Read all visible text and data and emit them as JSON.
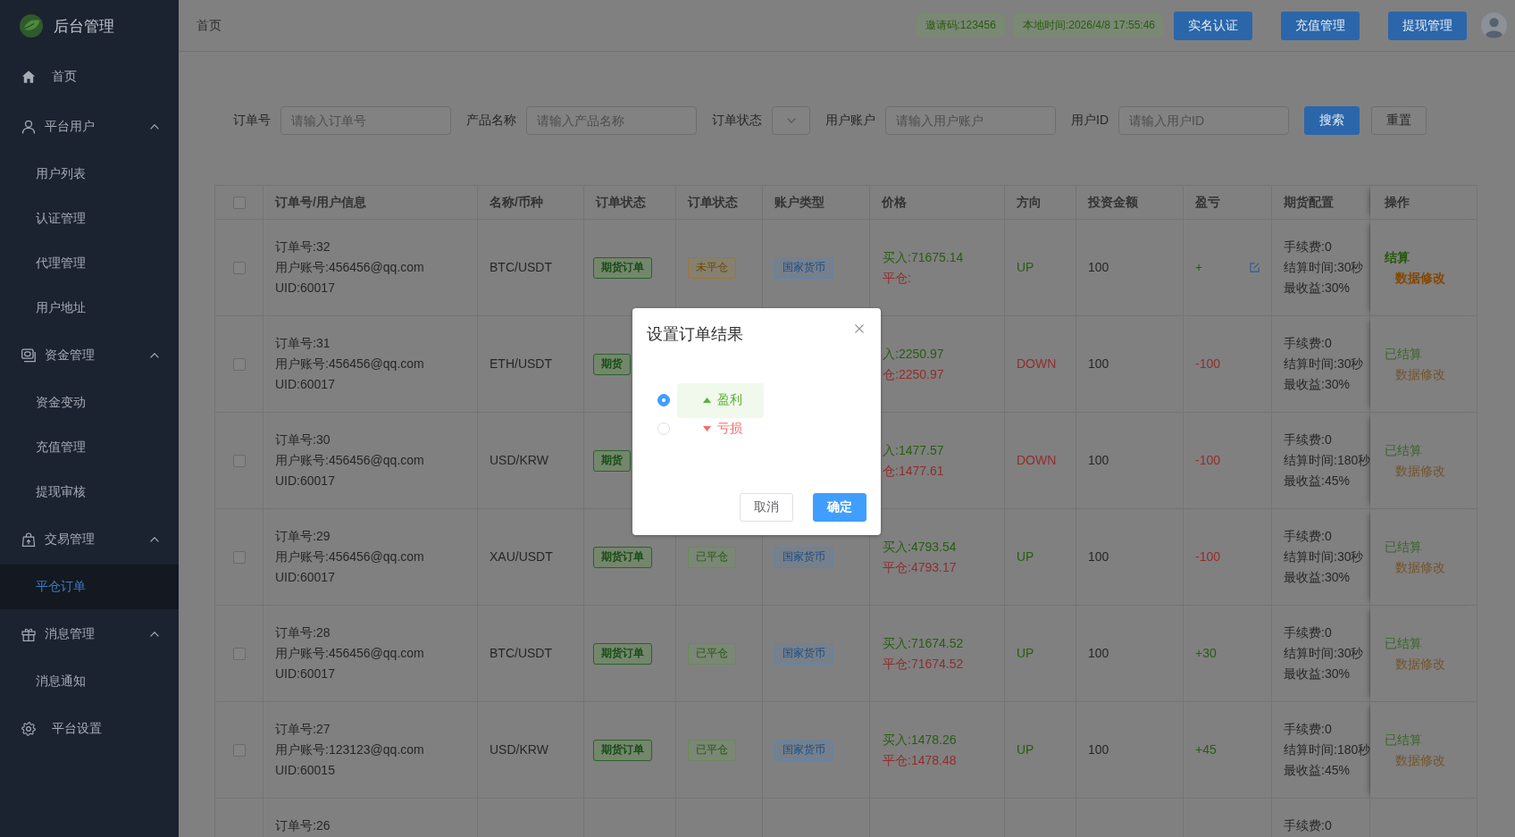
{
  "sidebar": {
    "logo_text": "后台管理",
    "items": [
      {
        "label": "首页",
        "kind": "link",
        "selected": false
      },
      {
        "label": "平台用户",
        "kind": "group",
        "expanded": true,
        "children": [
          {
            "label": "用户列表",
            "selected": false
          },
          {
            "label": "认证管理",
            "selected": false
          },
          {
            "label": "代理管理",
            "selected": false
          },
          {
            "label": "用户地址",
            "selected": false
          }
        ]
      },
      {
        "label": "资金管理",
        "kind": "group",
        "expanded": true,
        "children": [
          {
            "label": "资金变动",
            "selected": false
          },
          {
            "label": "充值管理",
            "selected": false
          },
          {
            "label": "提现审核",
            "selected": false
          }
        ]
      },
      {
        "label": "交易管理",
        "kind": "group",
        "expanded": true,
        "children": [
          {
            "label": "平仓订单",
            "selected": true
          }
        ]
      },
      {
        "label": "消息管理",
        "kind": "group",
        "expanded": true,
        "children": [
          {
            "label": "消息通知",
            "selected": false
          }
        ]
      },
      {
        "label": "平台设置",
        "kind": "link",
        "selected": false
      }
    ]
  },
  "header": {
    "breadcrumb": "首页",
    "tags": [
      "邀请码:123456",
      "本地时间:2026/4/8 17:55:46"
    ],
    "buttons": [
      "实名认证",
      "充值管理",
      "提现管理"
    ]
  },
  "filters": {
    "fields": [
      {
        "label": "订单号",
        "kind": "input",
        "placeholder": "请输入订单号"
      },
      {
        "label": "产品名称",
        "kind": "input",
        "placeholder": "请输入产品名称"
      },
      {
        "label": "订单状态",
        "kind": "select"
      },
      {
        "label": "用户账户",
        "kind": "input",
        "placeholder": "请输入用户账户"
      },
      {
        "label": "用户ID",
        "kind": "input",
        "placeholder": "请输入用户ID"
      }
    ],
    "buttons": [
      {
        "label": "搜索",
        "kind": "primary"
      },
      {
        "label": "重置",
        "kind": "default"
      }
    ]
  },
  "table": {
    "header_checkbox": {
      "checked": false
    },
    "columns": [
      "订单号/用户信息",
      "名称/币种",
      "订单状态",
      "订单状态",
      "账户类型",
      "价格",
      "方向",
      "投资金额",
      "盈亏",
      "期货配置",
      "操作"
    ],
    "rows": [
      {
        "checked": false,
        "info": [
          "订单号:32",
          "用户账号:456456@qq.com",
          "UID:60017"
        ],
        "symbol": "BTC/USDT",
        "order_type": "期货订单",
        "status": {
          "label": "未平仓",
          "kind": "open"
        },
        "account_type": "国家货币",
        "price": [
          {
            "text": "买入:71675.14",
            "kind": "buy"
          },
          {
            "text": "平仓:",
            "kind": "close"
          }
        ],
        "direction": {
          "text": "UP",
          "kind": "up"
        },
        "amount": "100",
        "pl": {
          "text": "+",
          "kind": "profit",
          "editable": true
        },
        "config": [
          "手续费:0",
          "结算时间:30秒",
          "最收益:30%"
        ],
        "actions": [
          {
            "label": "结算",
            "kind": "settle",
            "disabled": false
          },
          {
            "label": "数据修改",
            "kind": "edit",
            "disabled": false
          }
        ]
      },
      {
        "checked": false,
        "info": [
          "订单号:31",
          "用户账号:456456@qq.com",
          "UID:60017"
        ],
        "symbol": "ETH/USDT",
        "order_type": "期货",
        "price": [
          {
            "text": "入:2250.97",
            "kind": "buy"
          },
          {
            "text": "仓:2250.97",
            "kind": "close"
          }
        ],
        "direction": {
          "text": "DOWN",
          "kind": "down"
        },
        "amount": "100",
        "pl": {
          "text": "-100",
          "kind": "loss",
          "editable": false
        },
        "config": [
          "手续费:0",
          "结算时间:30秒",
          "最收益:30%"
        ],
        "actions": [
          {
            "label": "已结算",
            "kind": "settle",
            "disabled": true
          },
          {
            "label": "数据修改",
            "kind": "edit",
            "disabled": true
          }
        ]
      },
      {
        "checked": false,
        "info": [
          "订单号:30",
          "用户账号:456456@qq.com",
          "UID:60017"
        ],
        "symbol": "USD/KRW",
        "order_type": "期货",
        "price": [
          {
            "text": "入:1477.57",
            "kind": "buy"
          },
          {
            "text": "仓:1477.61",
            "kind": "close"
          }
        ],
        "direction": {
          "text": "DOWN",
          "kind": "down"
        },
        "amount": "100",
        "pl": {
          "text": "-100",
          "kind": "loss",
          "editable": false
        },
        "config": [
          "手续费:0",
          "结算时间:180秒",
          "最收益:45%"
        ],
        "actions": [
          {
            "label": "已结算",
            "kind": "settle",
            "disabled": true
          },
          {
            "label": "数据修改",
            "kind": "edit",
            "disabled": true
          }
        ]
      },
      {
        "checked": false,
        "info": [
          "订单号:29",
          "用户账号:456456@qq.com",
          "UID:60017"
        ],
        "symbol": "XAU/USDT",
        "order_type": "期货订单",
        "status": {
          "label": "已平仓",
          "kind": "closed"
        },
        "account_type": "国家货币",
        "price": [
          {
            "text": "买入:4793.54",
            "kind": "buy"
          },
          {
            "text": "平仓:4793.17",
            "kind": "close"
          }
        ],
        "direction": {
          "text": "UP",
          "kind": "up"
        },
        "amount": "100",
        "pl": {
          "text": "-100",
          "kind": "loss",
          "editable": false
        },
        "config": [
          "手续费:0",
          "结算时间:30秒",
          "最收益:30%"
        ],
        "actions": [
          {
            "label": "已结算",
            "kind": "settle",
            "disabled": true
          },
          {
            "label": "数据修改",
            "kind": "edit",
            "disabled": true
          }
        ]
      },
      {
        "checked": false,
        "info": [
          "订单号:28",
          "用户账号:456456@qq.com",
          "UID:60017"
        ],
        "symbol": "BTC/USDT",
        "order_type": "期货订单",
        "status": {
          "label": "已平仓",
          "kind": "closed"
        },
        "account_type": "国家货币",
        "price": [
          {
            "text": "买入:71674.52",
            "kind": "buy"
          },
          {
            "text": "平仓:71674.52",
            "kind": "close"
          }
        ],
        "direction": {
          "text": "UP",
          "kind": "up"
        },
        "amount": "100",
        "pl": {
          "text": "+30",
          "kind": "profit",
          "editable": false
        },
        "config": [
          "手续费:0",
          "结算时间:30秒",
          "最收益:30%"
        ],
        "actions": [
          {
            "label": "已结算",
            "kind": "settle",
            "disabled": true
          },
          {
            "label": "数据修改",
            "kind": "edit",
            "disabled": true
          }
        ]
      },
      {
        "checked": false,
        "info": [
          "订单号:27",
          "用户账号:123123@qq.com",
          "UID:60015"
        ],
        "symbol": "USD/KRW",
        "order_type": "期货订单",
        "status": {
          "label": "已平仓",
          "kind": "closed"
        },
        "account_type": "国家货币",
        "price": [
          {
            "text": "买入:1478.26",
            "kind": "buy"
          },
          {
            "text": "平仓:1478.48",
            "kind": "close"
          }
        ],
        "direction": {
          "text": "UP",
          "kind": "up"
        },
        "amount": "100",
        "pl": {
          "text": "+45",
          "kind": "profit",
          "editable": false
        },
        "config": [
          "手续费:0",
          "结算时间:180秒",
          "最收益:45%"
        ],
        "actions": [
          {
            "label": "已结算",
            "kind": "settle",
            "disabled": true
          },
          {
            "label": "数据修改",
            "kind": "edit",
            "disabled": true
          }
        ]
      },
      {
        "info": [
          "订单号:26"
        ],
        "config": [
          "手续费:0"
        ]
      }
    ]
  },
  "dialog": {
    "title": "设置订单结果",
    "options": [
      {
        "label": "盈利",
        "kind": "profit",
        "selected": true
      },
      {
        "label": "亏损",
        "kind": "loss",
        "selected": false
      }
    ],
    "buttons": [
      {
        "label": "取消",
        "kind": "default"
      },
      {
        "label": "确定",
        "kind": "primary"
      }
    ]
  }
}
